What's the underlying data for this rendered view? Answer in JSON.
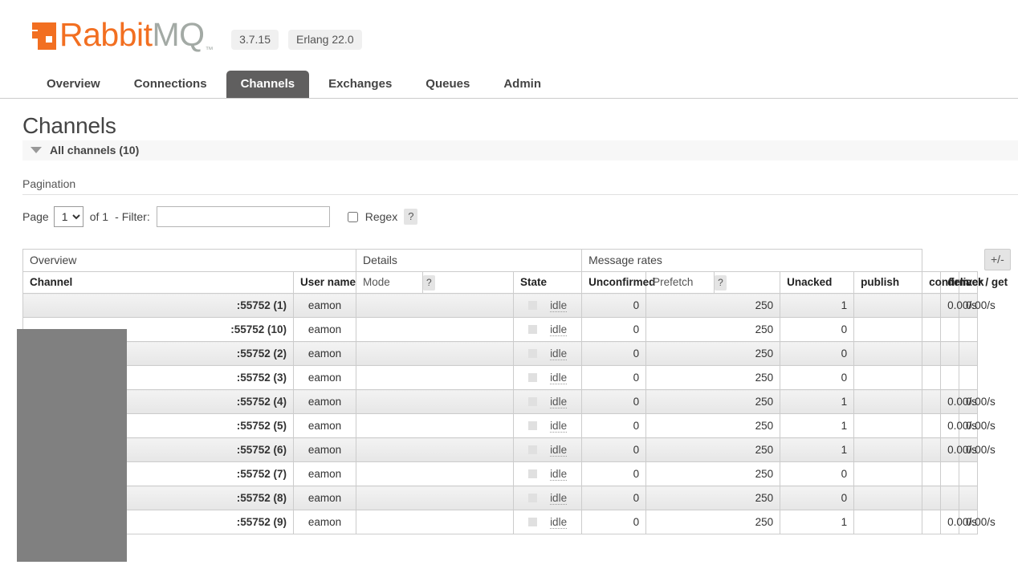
{
  "app": {
    "brand_rabbit": "Rabbit",
    "brand_mq": "MQ",
    "trademark": "™",
    "version": "3.7.15",
    "erlang_version": "Erlang 22.0",
    "accent_color": "#f26f21",
    "brand_gray": "#a3aaa5",
    "active_tab_bg": "#605f5f"
  },
  "nav": {
    "tabs": [
      {
        "label": "Overview",
        "active": false
      },
      {
        "label": "Connections",
        "active": false
      },
      {
        "label": "Channels",
        "active": true
      },
      {
        "label": "Exchanges",
        "active": false
      },
      {
        "label": "Queues",
        "active": false
      },
      {
        "label": "Admin",
        "active": false
      }
    ]
  },
  "page": {
    "title": "Channels",
    "section_label": "All channels (10)",
    "caret_icon": "caret-down-icon"
  },
  "pagination": {
    "heading": "Pagination",
    "page_label": "Page",
    "page_value": "1",
    "page_options": [
      "1"
    ],
    "of_label": "of 1",
    "dash": "-",
    "filter_label": "Filter:",
    "filter_value": "",
    "filter_placeholder": "",
    "regex_label": "Regex",
    "regex_checked": false,
    "regex_help": "?"
  },
  "table": {
    "toggle_columns_label": "+/-",
    "groups": [
      {
        "label": "Overview",
        "span": 4
      },
      {
        "label": "Details",
        "span": 3
      },
      {
        "label": "Message rates",
        "span": 4
      }
    ],
    "columns": [
      {
        "label": "Channel",
        "align": "left",
        "bold": true,
        "help": null
      },
      {
        "label": "User name",
        "align": "left",
        "bold": true,
        "help": null
      },
      {
        "label": "Mode",
        "align": "left",
        "bold": false,
        "help": "?"
      },
      {
        "label": "State",
        "align": "left",
        "bold": true,
        "help": null
      },
      {
        "label": "Unconfirmed",
        "align": "left",
        "bold": true,
        "help": null
      },
      {
        "label": "Prefetch",
        "align": "left",
        "bold": false,
        "help": "?"
      },
      {
        "label": "Unacked",
        "align": "left",
        "bold": true,
        "help": null
      },
      {
        "label": "publish",
        "align": "left",
        "bold": true,
        "help": null
      },
      {
        "label": "confirm",
        "align": "left",
        "bold": true,
        "help": null
      },
      {
        "label": "deliver / get",
        "align": "left",
        "bold": true,
        "help": null
      },
      {
        "label": "ack",
        "align": "left",
        "bold": true,
        "help": null
      }
    ],
    "state_icon": "status-square-icon",
    "rows": [
      {
        "channel": ":55752 (1)",
        "user": "eamon",
        "mode": "",
        "state": "idle",
        "unconfirmed": "0",
        "prefetch": "250",
        "unacked": "1",
        "publish": "",
        "confirm": "",
        "deliver_get": "0.00/s",
        "ack": "0.00/s"
      },
      {
        "channel": ":55752 (10)",
        "user": "eamon",
        "mode": "",
        "state": "idle",
        "unconfirmed": "0",
        "prefetch": "250",
        "unacked": "0",
        "publish": "",
        "confirm": "",
        "deliver_get": "",
        "ack": ""
      },
      {
        "channel": ":55752 (2)",
        "user": "eamon",
        "mode": "",
        "state": "idle",
        "unconfirmed": "0",
        "prefetch": "250",
        "unacked": "0",
        "publish": "",
        "confirm": "",
        "deliver_get": "",
        "ack": ""
      },
      {
        "channel": ":55752 (3)",
        "user": "eamon",
        "mode": "",
        "state": "idle",
        "unconfirmed": "0",
        "prefetch": "250",
        "unacked": "0",
        "publish": "",
        "confirm": "",
        "deliver_get": "",
        "ack": ""
      },
      {
        "channel": ":55752 (4)",
        "user": "eamon",
        "mode": "",
        "state": "idle",
        "unconfirmed": "0",
        "prefetch": "250",
        "unacked": "1",
        "publish": "",
        "confirm": "",
        "deliver_get": "0.00/s",
        "ack": "0.00/s"
      },
      {
        "channel": ":55752 (5)",
        "user": "eamon",
        "mode": "",
        "state": "idle",
        "unconfirmed": "0",
        "prefetch": "250",
        "unacked": "1",
        "publish": "",
        "confirm": "",
        "deliver_get": "0.00/s",
        "ack": "0.00/s"
      },
      {
        "channel": ":55752 (6)",
        "user": "eamon",
        "mode": "",
        "state": "idle",
        "unconfirmed": "0",
        "prefetch": "250",
        "unacked": "1",
        "publish": "",
        "confirm": "",
        "deliver_get": "0.00/s",
        "ack": "0.00/s"
      },
      {
        "channel": ":55752 (7)",
        "user": "eamon",
        "mode": "",
        "state": "idle",
        "unconfirmed": "0",
        "prefetch": "250",
        "unacked": "0",
        "publish": "",
        "confirm": "",
        "deliver_get": "",
        "ack": ""
      },
      {
        "channel": ":55752 (8)",
        "user": "eamon",
        "mode": "",
        "state": "idle",
        "unconfirmed": "0",
        "prefetch": "250",
        "unacked": "0",
        "publish": "",
        "confirm": "",
        "deliver_get": "",
        "ack": ""
      },
      {
        "channel": ":55752 (9)",
        "user": "eamon",
        "mode": "",
        "state": "idle",
        "unconfirmed": "0",
        "prefetch": "250",
        "unacked": "1",
        "publish": "",
        "confirm": "",
        "deliver_get": "0.00/s",
        "ack": "0.00/s"
      }
    ]
  }
}
